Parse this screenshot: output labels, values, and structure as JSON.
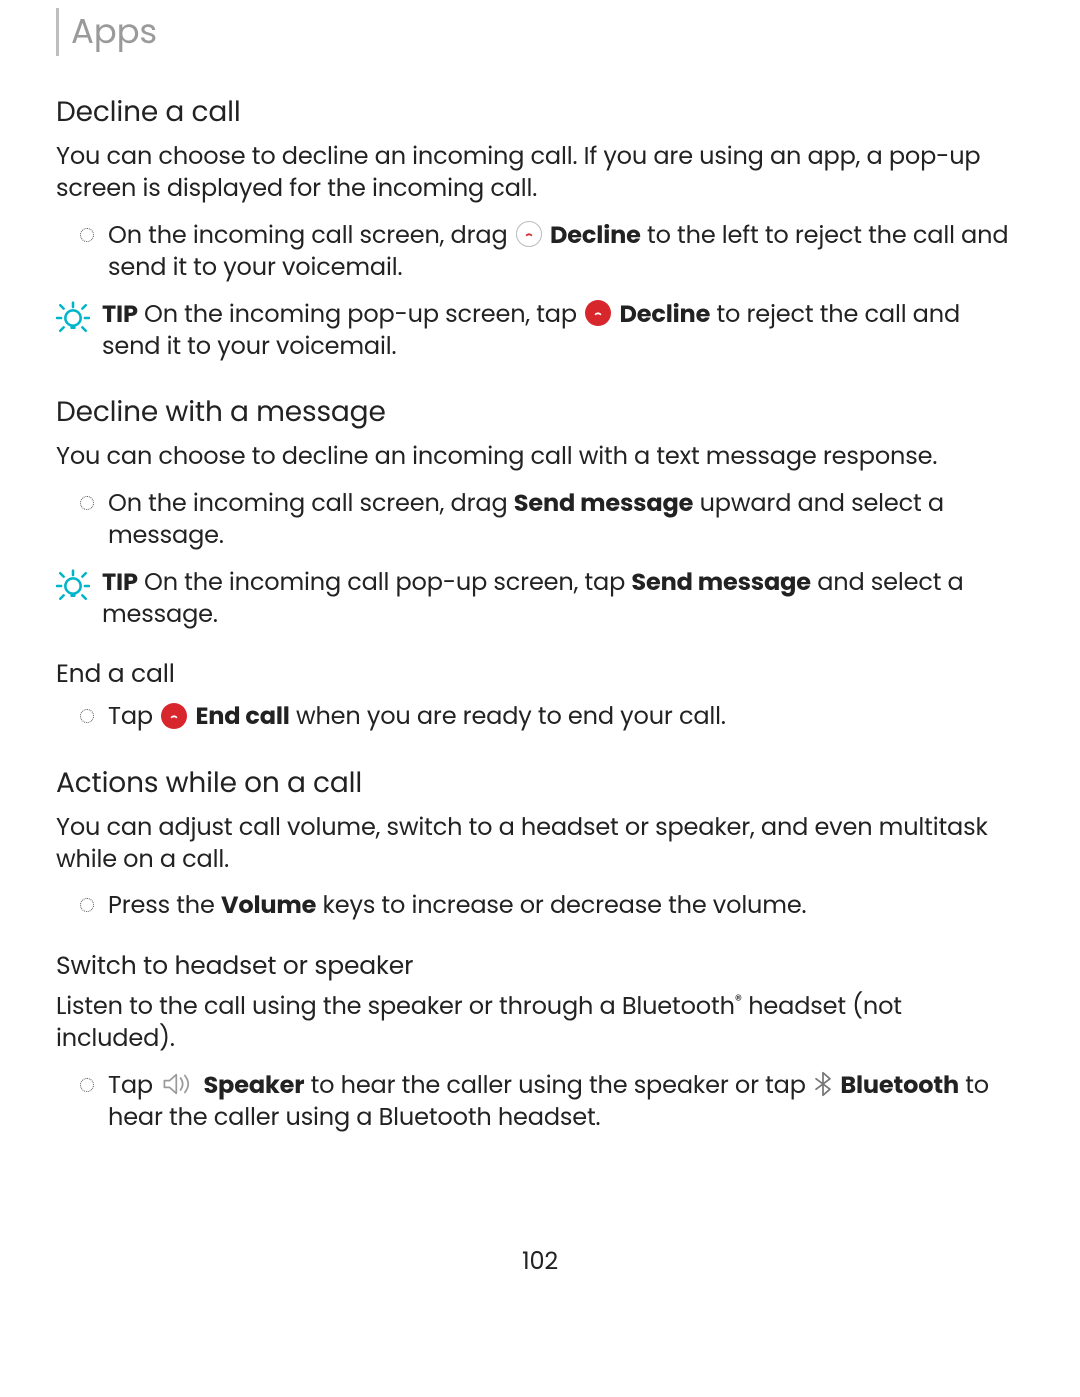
{
  "header": {
    "title": "Apps"
  },
  "sections": {
    "decline": {
      "heading": "Decline a call",
      "intro": "You can choose to decline an incoming call. If you are using an app, a pop-up screen is displayed for the incoming call.",
      "bullet_pre": "On the incoming call screen, drag ",
      "bullet_bold": "Decline",
      "bullet_post": " to the left to reject the call and send it to your voicemail.",
      "tip_label": "TIP",
      "tip_pre": " On the incoming pop-up screen, tap ",
      "tip_bold": "Decline",
      "tip_post": " to reject the call and send it to your voicemail."
    },
    "decline_msg": {
      "heading": "Decline with a message",
      "intro": "You can choose to decline an incoming call with a text message response.",
      "bullet_pre": "On the incoming call screen, drag ",
      "bullet_bold": "Send message",
      "bullet_post": " upward and select a message.",
      "tip_label": "TIP",
      "tip_pre": " On the incoming call pop-up screen, tap ",
      "tip_bold": "Send message",
      "tip_post": " and select a message."
    },
    "end": {
      "heading": "End a call",
      "bullet_pre": "Tap ",
      "bullet_bold": "End call",
      "bullet_post": " when you are ready to end your call."
    },
    "actions": {
      "heading": "Actions while on a call",
      "intro": "You can adjust call volume, switch to a headset or speaker, and even multitask while on a call.",
      "bullet_pre": "Press the ",
      "bullet_bold": "Volume",
      "bullet_post": " keys to increase or decrease the volume."
    },
    "switch": {
      "heading": "Switch to headset or speaker",
      "intro_pre": "Listen to the call using the speaker or through a Bluetooth",
      "intro_sup": "®",
      "intro_post": " headset (not included).",
      "bullet_pre": "Tap ",
      "bullet_bold1": "Speaker",
      "bullet_mid": " to hear the caller using the speaker or tap ",
      "bullet_bold2": "Bluetooth",
      "bullet_post": " to hear the caller using a Bluetooth headset."
    }
  },
  "page_number": "102"
}
